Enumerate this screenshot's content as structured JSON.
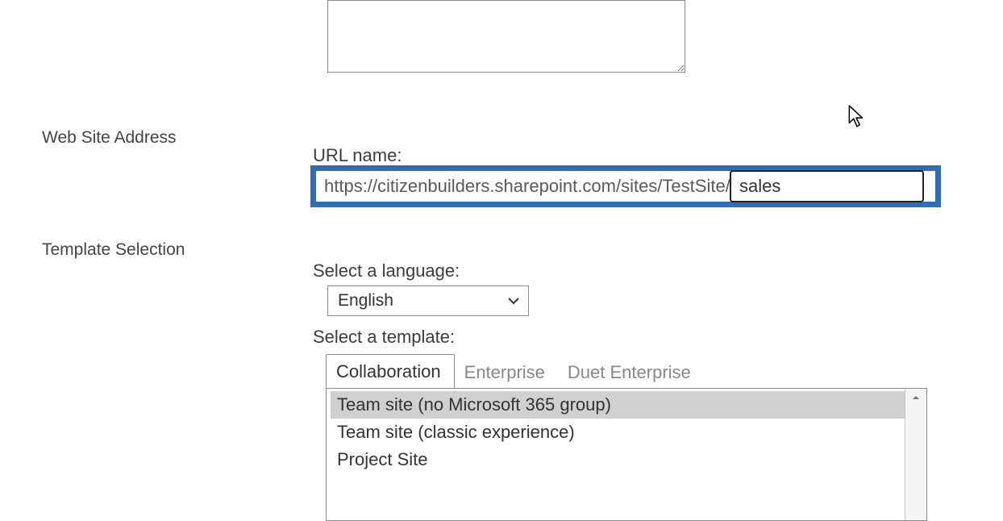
{
  "description_textarea_value": "",
  "sections": {
    "web_site_address_label": "Web Site Address",
    "template_selection_label": "Template Selection"
  },
  "url": {
    "label": "URL name:",
    "prefix": "https://citizenbuilders.sharepoint.com/sites/TestSite/",
    "value": "sales"
  },
  "language": {
    "label": "Select a language:",
    "selected": "English"
  },
  "templates": {
    "label": "Select a template:",
    "tabs": {
      "collaboration": "Collaboration",
      "enterprise": "Enterprise",
      "duet": "Duet Enterprise"
    },
    "items": {
      "0": "Team site (no Microsoft 365 group)",
      "1": "Team site (classic experience)",
      "2": "Project Site"
    }
  }
}
